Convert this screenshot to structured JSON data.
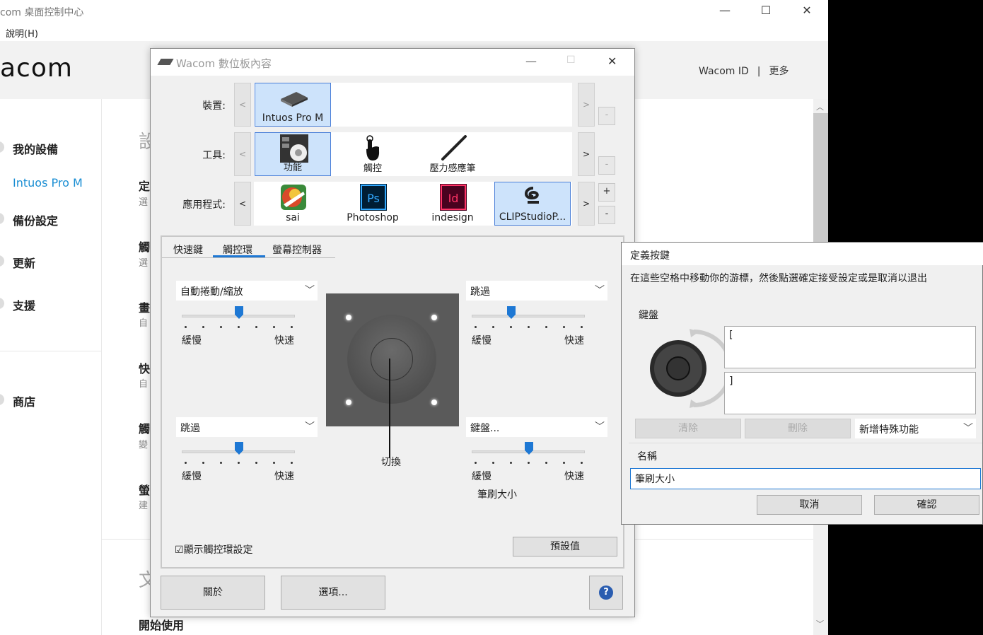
{
  "main_window": {
    "title": "com 桌面控制中心",
    "menu_help": "說明(H)",
    "logo": "acom",
    "header_links": [
      "Wacom ID",
      "更多"
    ],
    "controls": {
      "minimize": "—",
      "maximize": "☐",
      "close": "✕"
    },
    "sidebar": {
      "items": [
        {
          "label": "我的設備"
        },
        {
          "label": "備份設定"
        },
        {
          "label": "更新"
        },
        {
          "label": "支援"
        },
        {
          "label": "商店"
        }
      ],
      "active_device": "Intuos Pro M"
    },
    "content": {
      "heading": "設",
      "sections": [
        {
          "label": "定",
          "sub": "選"
        },
        {
          "label": "觸",
          "sub": "選"
        },
        {
          "label": "畫",
          "sub": "自"
        },
        {
          "label": "快",
          "sub": "自"
        },
        {
          "label": "觸",
          "sub": "變"
        },
        {
          "label": "螢",
          "sub": "建"
        }
      ],
      "bottom_heading": "文",
      "getting_started": "開始使用"
    }
  },
  "tablet_props": {
    "title": "Wacom 數位板內容",
    "row_labels": {
      "device": "裝置:",
      "tool": "工具:",
      "app": "應用程式:"
    },
    "devices": [
      {
        "label": "Intuos Pro M",
        "icon": "tablet-icon"
      }
    ],
    "tools": [
      {
        "label": "功能",
        "icon": "express-keys-icon"
      },
      {
        "label": "觸控",
        "icon": "touch-hand-icon"
      },
      {
        "label": "壓力感應筆",
        "icon": "pen-icon"
      }
    ],
    "apps": [
      {
        "label": "sai",
        "icon": "sai-icon"
      },
      {
        "label": "Photoshop",
        "icon": "photoshop-icon"
      },
      {
        "label": "indesign",
        "icon": "indesign-icon"
      },
      {
        "label": "CLIPStudioP...",
        "icon": "clip-studio-icon"
      }
    ],
    "nav": {
      "prev": "<",
      "next": ">",
      "add": "+",
      "remove": "-"
    },
    "tabs": [
      "快速鍵",
      "觸控環",
      "螢幕控制器"
    ],
    "active_tab": "觸控環",
    "ring": {
      "top_left": {
        "mode": "自動捲動/縮放",
        "slow": "緩慢",
        "fast": "快速",
        "level": 0.5
      },
      "top_right": {
        "mode": "跳過",
        "slow": "緩慢",
        "fast": "快速",
        "level": 0.4
      },
      "bottom_left": {
        "mode": "跳過",
        "slow": "緩慢",
        "fast": "快速",
        "level": 0.5
      },
      "bottom_right": {
        "mode": "鍵盤...",
        "slow": "緩慢",
        "fast": "快速",
        "level": 0.5,
        "name": "筆刷大小"
      },
      "toggle_label": "切換"
    },
    "show_settings": {
      "checked": true,
      "label": "顯示觸控環設定",
      "check_glyph": "☑"
    },
    "default_button": "預設值",
    "about_button": "關於",
    "options_button": "選項...",
    "help_glyph": "?"
  },
  "define_key": {
    "title": "定義按鍵",
    "instruction": "在這些空格中移動你的游標，然後點選確定接受設定或是取消以退出",
    "group_label": "鍵盤",
    "key_up": "[",
    "key_down": "]",
    "clear_button": "清除",
    "delete_button": "刪除",
    "special_dropdown": "新增特殊功能",
    "name_label": "名稱",
    "name_value": "筆刷大小",
    "cancel_button": "取消",
    "ok_button": "確認"
  }
}
